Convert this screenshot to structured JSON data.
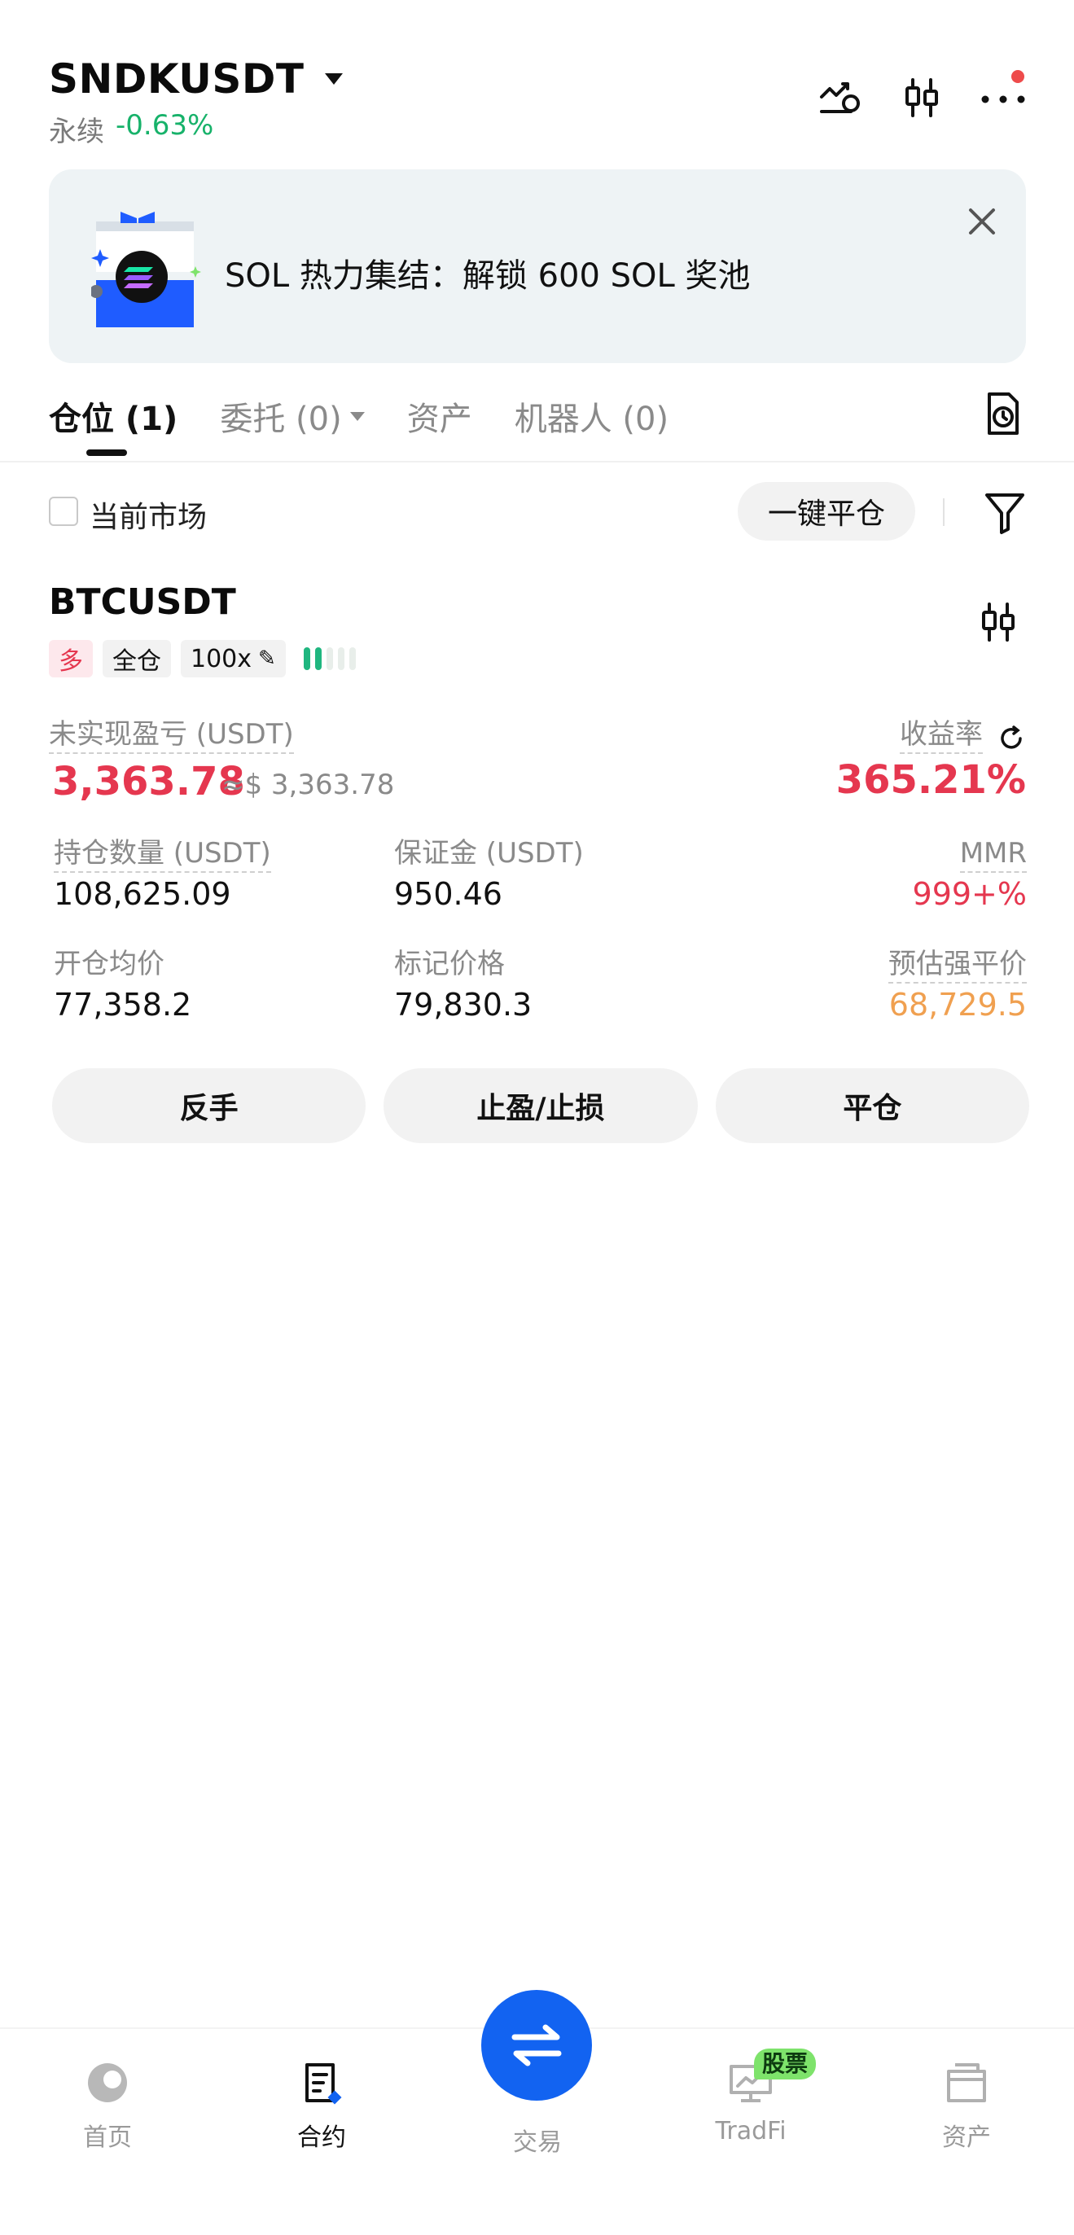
{
  "header": {
    "symbol": "SNDKUSDT",
    "type": "永续",
    "change": "-0.63%"
  },
  "icons": {
    "strategy": "strategy-icon",
    "candles": "candlestick-icon",
    "more": "more-icon",
    "close": "close-icon",
    "history": "history-icon",
    "filter": "filter-icon",
    "refresh": "refresh-icon",
    "edit": "pencil-icon"
  },
  "banner": {
    "text": "SOL 热力集结：解锁 600 SOL 奖池"
  },
  "tabs": [
    {
      "label": "仓位 (1)"
    },
    {
      "label": "委托 (0)"
    },
    {
      "label": "资产"
    },
    {
      "label": "机器人 (0)"
    }
  ],
  "filter": {
    "current_market": "当前市场",
    "close_all": "一键平仓"
  },
  "position": {
    "symbol": "BTCUSDT",
    "side": "多",
    "margin_mode": "全仓",
    "leverage": "100x",
    "risk_level": 2,
    "risk_level_max": 5,
    "upnl_label": "未实现盈亏 (USDT)",
    "upnl": "3,363.78",
    "upnl_usd": "≈$ 3,363.78",
    "roe_label": "收益率",
    "roe": "365.21%",
    "size_label": "持仓数量 (USDT)",
    "size": "108,625.09",
    "margin_label": "保证金 (USDT)",
    "margin": "950.46",
    "mmr_label": "MMR",
    "mmr": "999+%",
    "entry_label": "开仓均价",
    "entry": "77,358.2",
    "mark_label": "标记价格",
    "mark": "79,830.3",
    "liq_label": "预估强平价",
    "liq": "68,729.5",
    "btn_reverse": "反手",
    "btn_tpsl": "止盈/止损",
    "btn_close": "平仓"
  },
  "colors": {
    "green": "#17b26a",
    "red": "#e5374f",
    "orange": "#f0a050",
    "blue": "#1263f1",
    "badge_green": "#7ee36b"
  },
  "nav": {
    "home": "首页",
    "futures": "合约",
    "trade": "交易",
    "tradfi": "TradFi",
    "tradfi_badge": "股票",
    "assets": "资产"
  }
}
